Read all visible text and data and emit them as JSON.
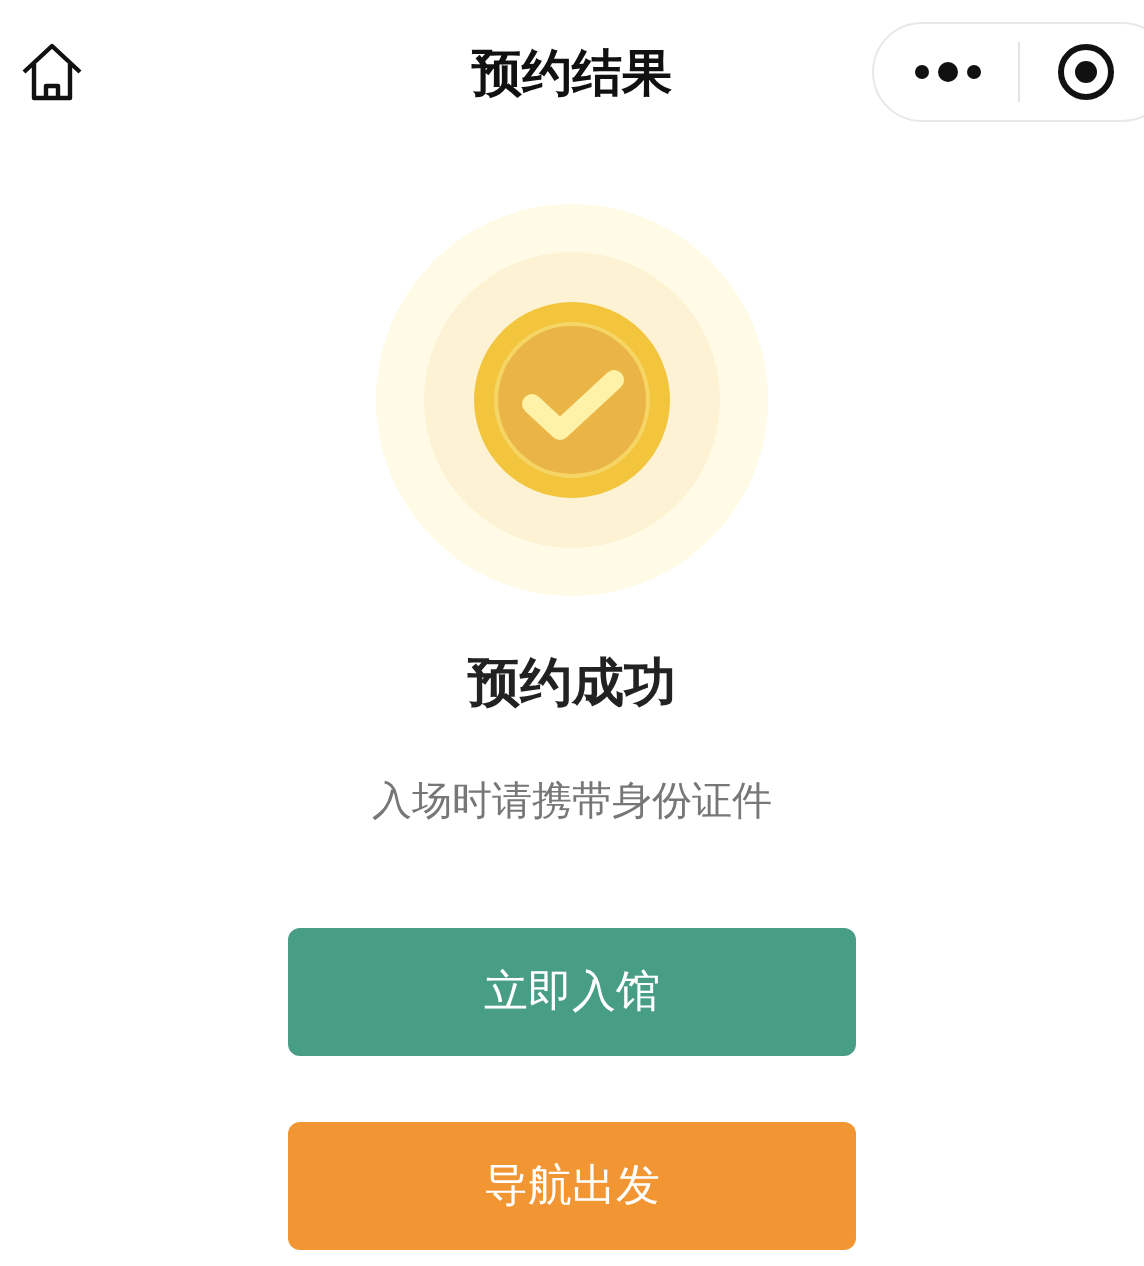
{
  "nav": {
    "title": "预约结果"
  },
  "result": {
    "title": "预约成功",
    "message": "入场时请携带身份证件"
  },
  "buttons": [
    {
      "label": "立即入馆",
      "color": "#489e84"
    },
    {
      "label": "导航出发",
      "color": "#f29634"
    }
  ]
}
